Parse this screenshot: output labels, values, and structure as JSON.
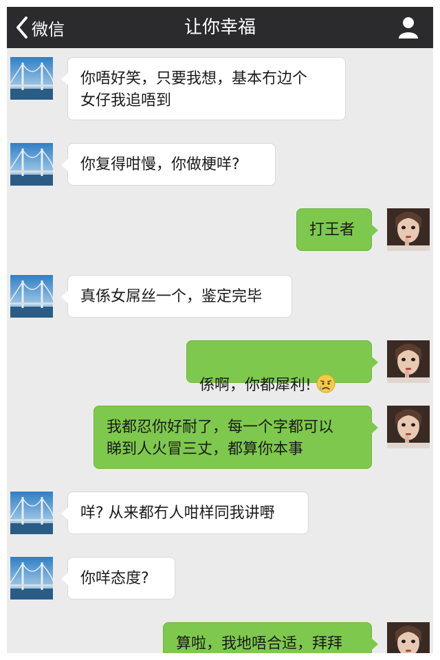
{
  "navbar": {
    "back_label": "微信",
    "title": "让你幸福",
    "back_icon": "chevron-left-icon",
    "profile_icon": "person-icon"
  },
  "colors": {
    "navbar_bg": "#2b2b2d",
    "chat_bg": "#ebebeb",
    "incoming_bubble": "#ffffff",
    "outgoing_bubble": "#7ec94d"
  },
  "messages": [
    {
      "side": "left",
      "text": "你唔好笑，只要我想，基本冇边个\n女仔我追唔到"
    },
    {
      "side": "left",
      "text": "你复得咁慢，你做梗咩?"
    },
    {
      "side": "right",
      "text": "打王者"
    },
    {
      "side": "left",
      "text": "真係女屌丝一个，鉴定完毕"
    },
    {
      "side": "right",
      "text": "係啊，你都犀利!",
      "emoji": "sad-face-emoji"
    },
    {
      "side": "right",
      "text": "我都忍你好耐了，每一个字都可以\n睇到人火冒三丈，都算你本事"
    },
    {
      "side": "left",
      "text": "咩? 从来都冇人咁样同我讲嘢"
    },
    {
      "side": "left",
      "text": "你咩态度?"
    },
    {
      "side": "right",
      "text": "算啦，我地唔合适，拜拜"
    }
  ]
}
